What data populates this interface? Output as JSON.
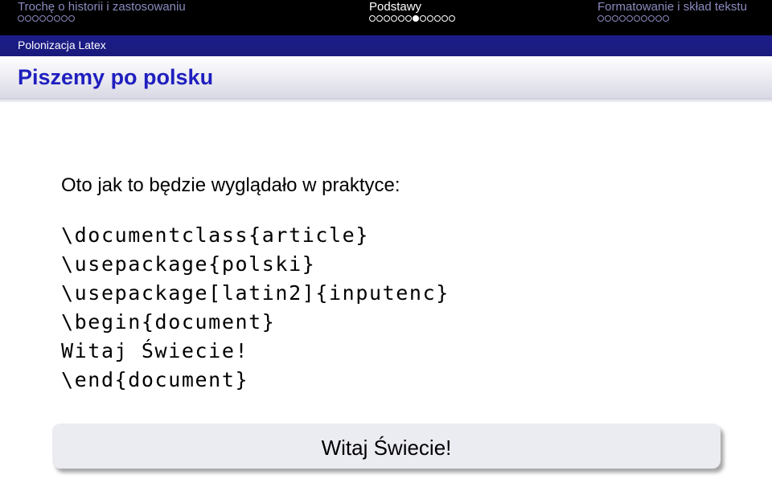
{
  "nav": {
    "sections": [
      {
        "title": "Trochę o historii i zastosowaniu",
        "dots": 8,
        "current": -1
      },
      {
        "title": "Podstawy",
        "dots": 12,
        "current": 6
      },
      {
        "title": "Formatowanie i skład tekstu",
        "dots": 10,
        "current": -1
      }
    ]
  },
  "subsection": "Polonizacja Latex",
  "frame_title": "Piszemy po polsku",
  "intro": "Oto jak to będzie wyglądało w praktyce:",
  "code_lines": [
    "\\documentclass{article}",
    "\\usepackage{polski}",
    "\\usepackage[latin2]{inputenc}",
    "\\begin{document}",
    "Witaj Świecie!",
    "\\end{document}"
  ],
  "result": "Witaj Świecie!"
}
